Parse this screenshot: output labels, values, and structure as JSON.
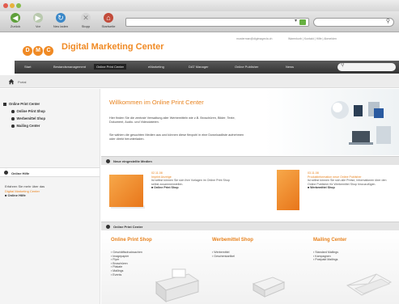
{
  "toolbar": {
    "back": "Zurück",
    "forward": "Vor",
    "refresh": "Neu laden",
    "stop": "Stopp",
    "home": "Startseite"
  },
  "header": {
    "logo_letters": [
      "D",
      "M",
      "C"
    ],
    "logo_text": "Digital Marketing Center",
    "mail": "musterman@digimagecla.ch",
    "links": "Warenkorb  |  Kontakt  |  Hilfe  |  Abmelden"
  },
  "nav": {
    "items": [
      "Start",
      "Bestandsmanagement",
      "Online Print Center",
      "eMarketing",
      "DAT Manager",
      "Online Publisher",
      "News"
    ],
    "active_index": 2
  },
  "breadcrumb": {
    "crumb": "Portal"
  },
  "sidebar": {
    "tree": [
      {
        "label": "Online Print Center",
        "level": 0
      },
      {
        "label": "Online Print Shop",
        "level": 1
      },
      {
        "label": "Werbemittel Shop",
        "level": 1
      },
      {
        "label": "Mailing Center",
        "level": 1
      }
    ],
    "hilfe_title": "Online Hilfe",
    "hilfe_text": "Erfahren Sie mehr über das",
    "hilfe_link": "Digital Marketing Center",
    "hilfe_more": "Online Hilfe"
  },
  "welcome": {
    "title": "Willkommen im Online Print Center",
    "p1": "Hier finden Sie die zentrale Verwaltung aller Werbemitteln wie z.B. Broschüren, Bilder, Texte, Dokument, Audio- und Videodateien.",
    "p2": "Sie wählen die gesuchten Medien aus und können diese flexpohl in eine Downloadliste aufnehmen oder direkt herunterladen."
  },
  "newproducts": {
    "title": "Neue eingestellte Medien",
    "item1": {
      "date": "02.11.08",
      "name": "Imprint Anzeige",
      "desc": "Ist selbst können Sie sich Ihre Vorlagen im Online Print Shop selbst zusammenstellen.",
      "link": "Online Print Shop"
    },
    "item2": {
      "date": "03.11.08",
      "name": "Produktinformation neue Online Publisher",
      "desc": "Ist selbst können Sie sich alle Preise, Informationen über den Online Publisher für Werbemittel Shop hinzuzufügen.",
      "link": "Werbemittel Shop"
    }
  },
  "opc": {
    "title": "Online Print Center",
    "col1": {
      "title": "Online Print Shop",
      "items": [
        "Geschäftsdrucksachen",
        "Imagepapier",
        "Flyer",
        "Broschüren",
        "Plakate",
        "Mailings",
        "Events"
      ]
    },
    "col2": {
      "title": "Werbemittel Shop",
      "items": [
        "Werbemittel",
        "Geschenkartikel"
      ]
    },
    "col3": {
      "title": "Mailing Center",
      "items": [
        "Standard Mailings",
        "Kampagnen",
        "Postpakt Mailings"
      ]
    }
  },
  "colors": {
    "accent": "#e8821d",
    "nav_bg": "#3f3f3f",
    "logo": "#f08a24"
  }
}
